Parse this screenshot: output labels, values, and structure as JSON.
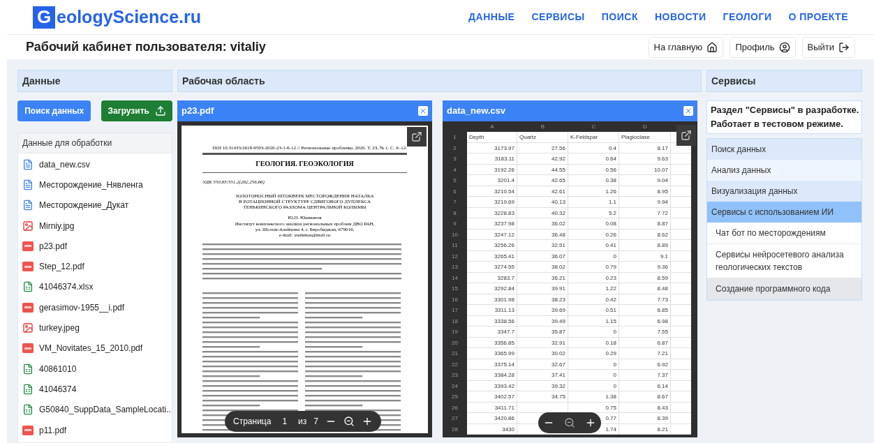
{
  "logo": {
    "letter": "G",
    "rest": "eologyScience.ru"
  },
  "nav": [
    "ДАННЫЕ",
    "СЕРВИСЫ",
    "ПОИСК",
    "НОВОСТИ",
    "ГЕОЛОГИ",
    "О ПРОЕКТЕ"
  ],
  "page_title": "Рабочий кабинет пользователя: vitaliy",
  "header_buttons": [
    {
      "label": "На главную",
      "kind": "home"
    },
    {
      "label": "Профиль",
      "kind": "profile"
    },
    {
      "label": "Выйти",
      "kind": "logout"
    }
  ],
  "data_panel": {
    "title": "Данные",
    "buttons": [
      {
        "label": "Поиск данных",
        "kind": "search"
      },
      {
        "label": "Загрузить",
        "kind": "upload"
      }
    ],
    "files_title": "Данные для обработки",
    "files": [
      {
        "name": "data_new.csv",
        "kind": "doc"
      },
      {
        "name": "Месторождение_Нявленга",
        "kind": "doc"
      },
      {
        "name": "Месторождение_Дукат",
        "kind": "doc"
      },
      {
        "name": "Mirniy.jpg",
        "kind": "image"
      },
      {
        "name": "p23.pdf",
        "kind": "pdf"
      },
      {
        "name": "Step_12.pdf",
        "kind": "pdf"
      },
      {
        "name": "41046374.xlsx",
        "kind": "excel"
      },
      {
        "name": "gerasimov-1955__i.pdf",
        "kind": "pdf"
      },
      {
        "name": "turkey.jpeg",
        "kind": "image"
      },
      {
        "name": "VM_Novitates_15_2010.pdf",
        "kind": "pdf"
      },
      {
        "name": "40861010",
        "kind": "excel"
      },
      {
        "name": "41046374",
        "kind": "excel"
      },
      {
        "name": "G50840_SuppData_SampleLocati...",
        "kind": "excel"
      },
      {
        "name": "p11.pdf",
        "kind": "pdf"
      }
    ]
  },
  "workspace": {
    "title": "Рабочая область",
    "pdf": {
      "title": "p23.pdf",
      "doi": "DOI 10.31433/2618-9593-2020-23-1-6-12 // Региональные проблемы. 2020. Т. 23, № 1. С. 6–12.",
      "section": "ГЕОЛОГИЯ. ГЕОЭКОЛОГИЯ",
      "udk": "УДК 550.83:551.2(282.256.86)",
      "article_title": [
        "ЗОЛОТОНОСНЫЙ ШТОКВЕРК МЕСТОРОЖДЕНИЯ НАТАЛКА",
        "В РОТАЦИОННОЙ СТРУКТУРЕ СДВИГОВОГО ДУПЛЕКСА",
        "ТЕНЬКИНСКОГО РАЗЛОМА ЦЕНТРАЛЬНОЙ КОЛЫМЫ"
      ],
      "author": "Ю.П. Юшманов",
      "affiliation": [
        "Институт комплексного анализа региональных проблем ДВО РАН,",
        "ул. Шолом-Алейхема 4, г. Биробиджан, 679016,",
        "e-mail: yushman@mail.ru"
      ],
      "toolbar": {
        "page_label": "Страница",
        "page": "1",
        "of": "из",
        "total": "7"
      }
    },
    "csv": {
      "title": "data_new.csv",
      "columns": [
        "A",
        "B",
        "C",
        "D"
      ],
      "header": {
        "n": "1",
        "cells": [
          "Depth",
          "Quartz",
          "K-Feldspar",
          "Plagioclase"
        ]
      },
      "rows": [
        {
          "n": "2",
          "cells": [
            "3173.97",
            "27.56",
            "0.4",
            "8.17"
          ]
        },
        {
          "n": "3",
          "cells": [
            "3183.11",
            "42.92",
            "0.64",
            "9.63"
          ]
        },
        {
          "n": "4",
          "cells": [
            "3192.26",
            "44.55",
            "0.56",
            "10.07"
          ]
        },
        {
          "n": "5",
          "cells": [
            "3201.4",
            "42.65",
            "0.38",
            "9.04"
          ]
        },
        {
          "n": "6",
          "cells": [
            "3210.54",
            "42.61",
            "1.26",
            "8.95"
          ]
        },
        {
          "n": "7",
          "cells": [
            "3219.69",
            "40.13",
            "1.1",
            "9.94"
          ]
        },
        {
          "n": "8",
          "cells": [
            "3228.83",
            "40.32",
            "5.2",
            "7.72"
          ]
        },
        {
          "n": "9",
          "cells": [
            "3237.98",
            "36.02",
            "0.08",
            "8.87"
          ]
        },
        {
          "n": "10",
          "cells": [
            "3247.12",
            "36.48",
            "0.26",
            "8.62"
          ]
        },
        {
          "n": "11",
          "cells": [
            "3256.26",
            "32.51",
            "0.41",
            "8.89"
          ]
        },
        {
          "n": "12",
          "cells": [
            "3265.41",
            "36.07",
            "0",
            "9.1"
          ]
        },
        {
          "n": "13",
          "cells": [
            "3274.55",
            "38.02",
            "0.79",
            "9.36"
          ]
        },
        {
          "n": "14",
          "cells": [
            "3283.7",
            "36.21",
            "0.23",
            "8.59"
          ]
        },
        {
          "n": "15",
          "cells": [
            "3292.84",
            "39.91",
            "1.22",
            "8.48"
          ]
        },
        {
          "n": "16",
          "cells": [
            "3301.98",
            "38.23",
            "0.42",
            "7.73"
          ]
        },
        {
          "n": "17",
          "cells": [
            "3311.13",
            "39.69",
            "0.51",
            "6.85"
          ]
        },
        {
          "n": "18",
          "cells": [
            "3338.56",
            "39.49",
            "1.15",
            "6.98"
          ]
        },
        {
          "n": "19",
          "cells": [
            "3347.7",
            "35.87",
            "0",
            "7.55"
          ]
        },
        {
          "n": "20",
          "cells": [
            "3356.85",
            "32.91",
            "0.18",
            "6.87"
          ]
        },
        {
          "n": "21",
          "cells": [
            "3365.99",
            "30.02",
            "0.29",
            "7.21"
          ]
        },
        {
          "n": "22",
          "cells": [
            "3375.14",
            "32.67",
            "0",
            "6.92"
          ]
        },
        {
          "n": "23",
          "cells": [
            "3384.28",
            "37.41",
            "0",
            "7.37"
          ]
        },
        {
          "n": "24",
          "cells": [
            "3393.42",
            "39.32",
            "0",
            "6.14"
          ]
        },
        {
          "n": "25",
          "cells": [
            "3402.57",
            "34.75",
            "1.38",
            "8.67"
          ]
        },
        {
          "n": "26",
          "cells": [
            "3411.71",
            null,
            "0.75",
            "8.43"
          ]
        },
        {
          "n": "27",
          "cells": [
            "3420.86",
            null,
            "0.77",
            "8.39"
          ]
        },
        {
          "n": "28",
          "cells": [
            "3430",
            null,
            "1.74",
            "8.21"
          ]
        }
      ]
    }
  },
  "services": {
    "title": "Сервисы",
    "notice": [
      "Раздел \"Сервисы\" в разработке.",
      "Работает в тестовом режиме."
    ],
    "items": [
      {
        "label": "Поиск данных",
        "selected": false
      },
      {
        "label": "Анализ данных",
        "selected": false
      },
      {
        "label": "Визуализация данных",
        "selected": false
      },
      {
        "label": "Сервисы с использованием ИИ",
        "selected": true,
        "children": [
          {
            "label": "Чат бот по месторождениям",
            "selected": false
          },
          {
            "label": "Сервисы нейросетевого анализа геологических текстов",
            "selected": false
          },
          {
            "label": "Создание программного кода",
            "selected": true
          }
        ]
      }
    ]
  }
}
